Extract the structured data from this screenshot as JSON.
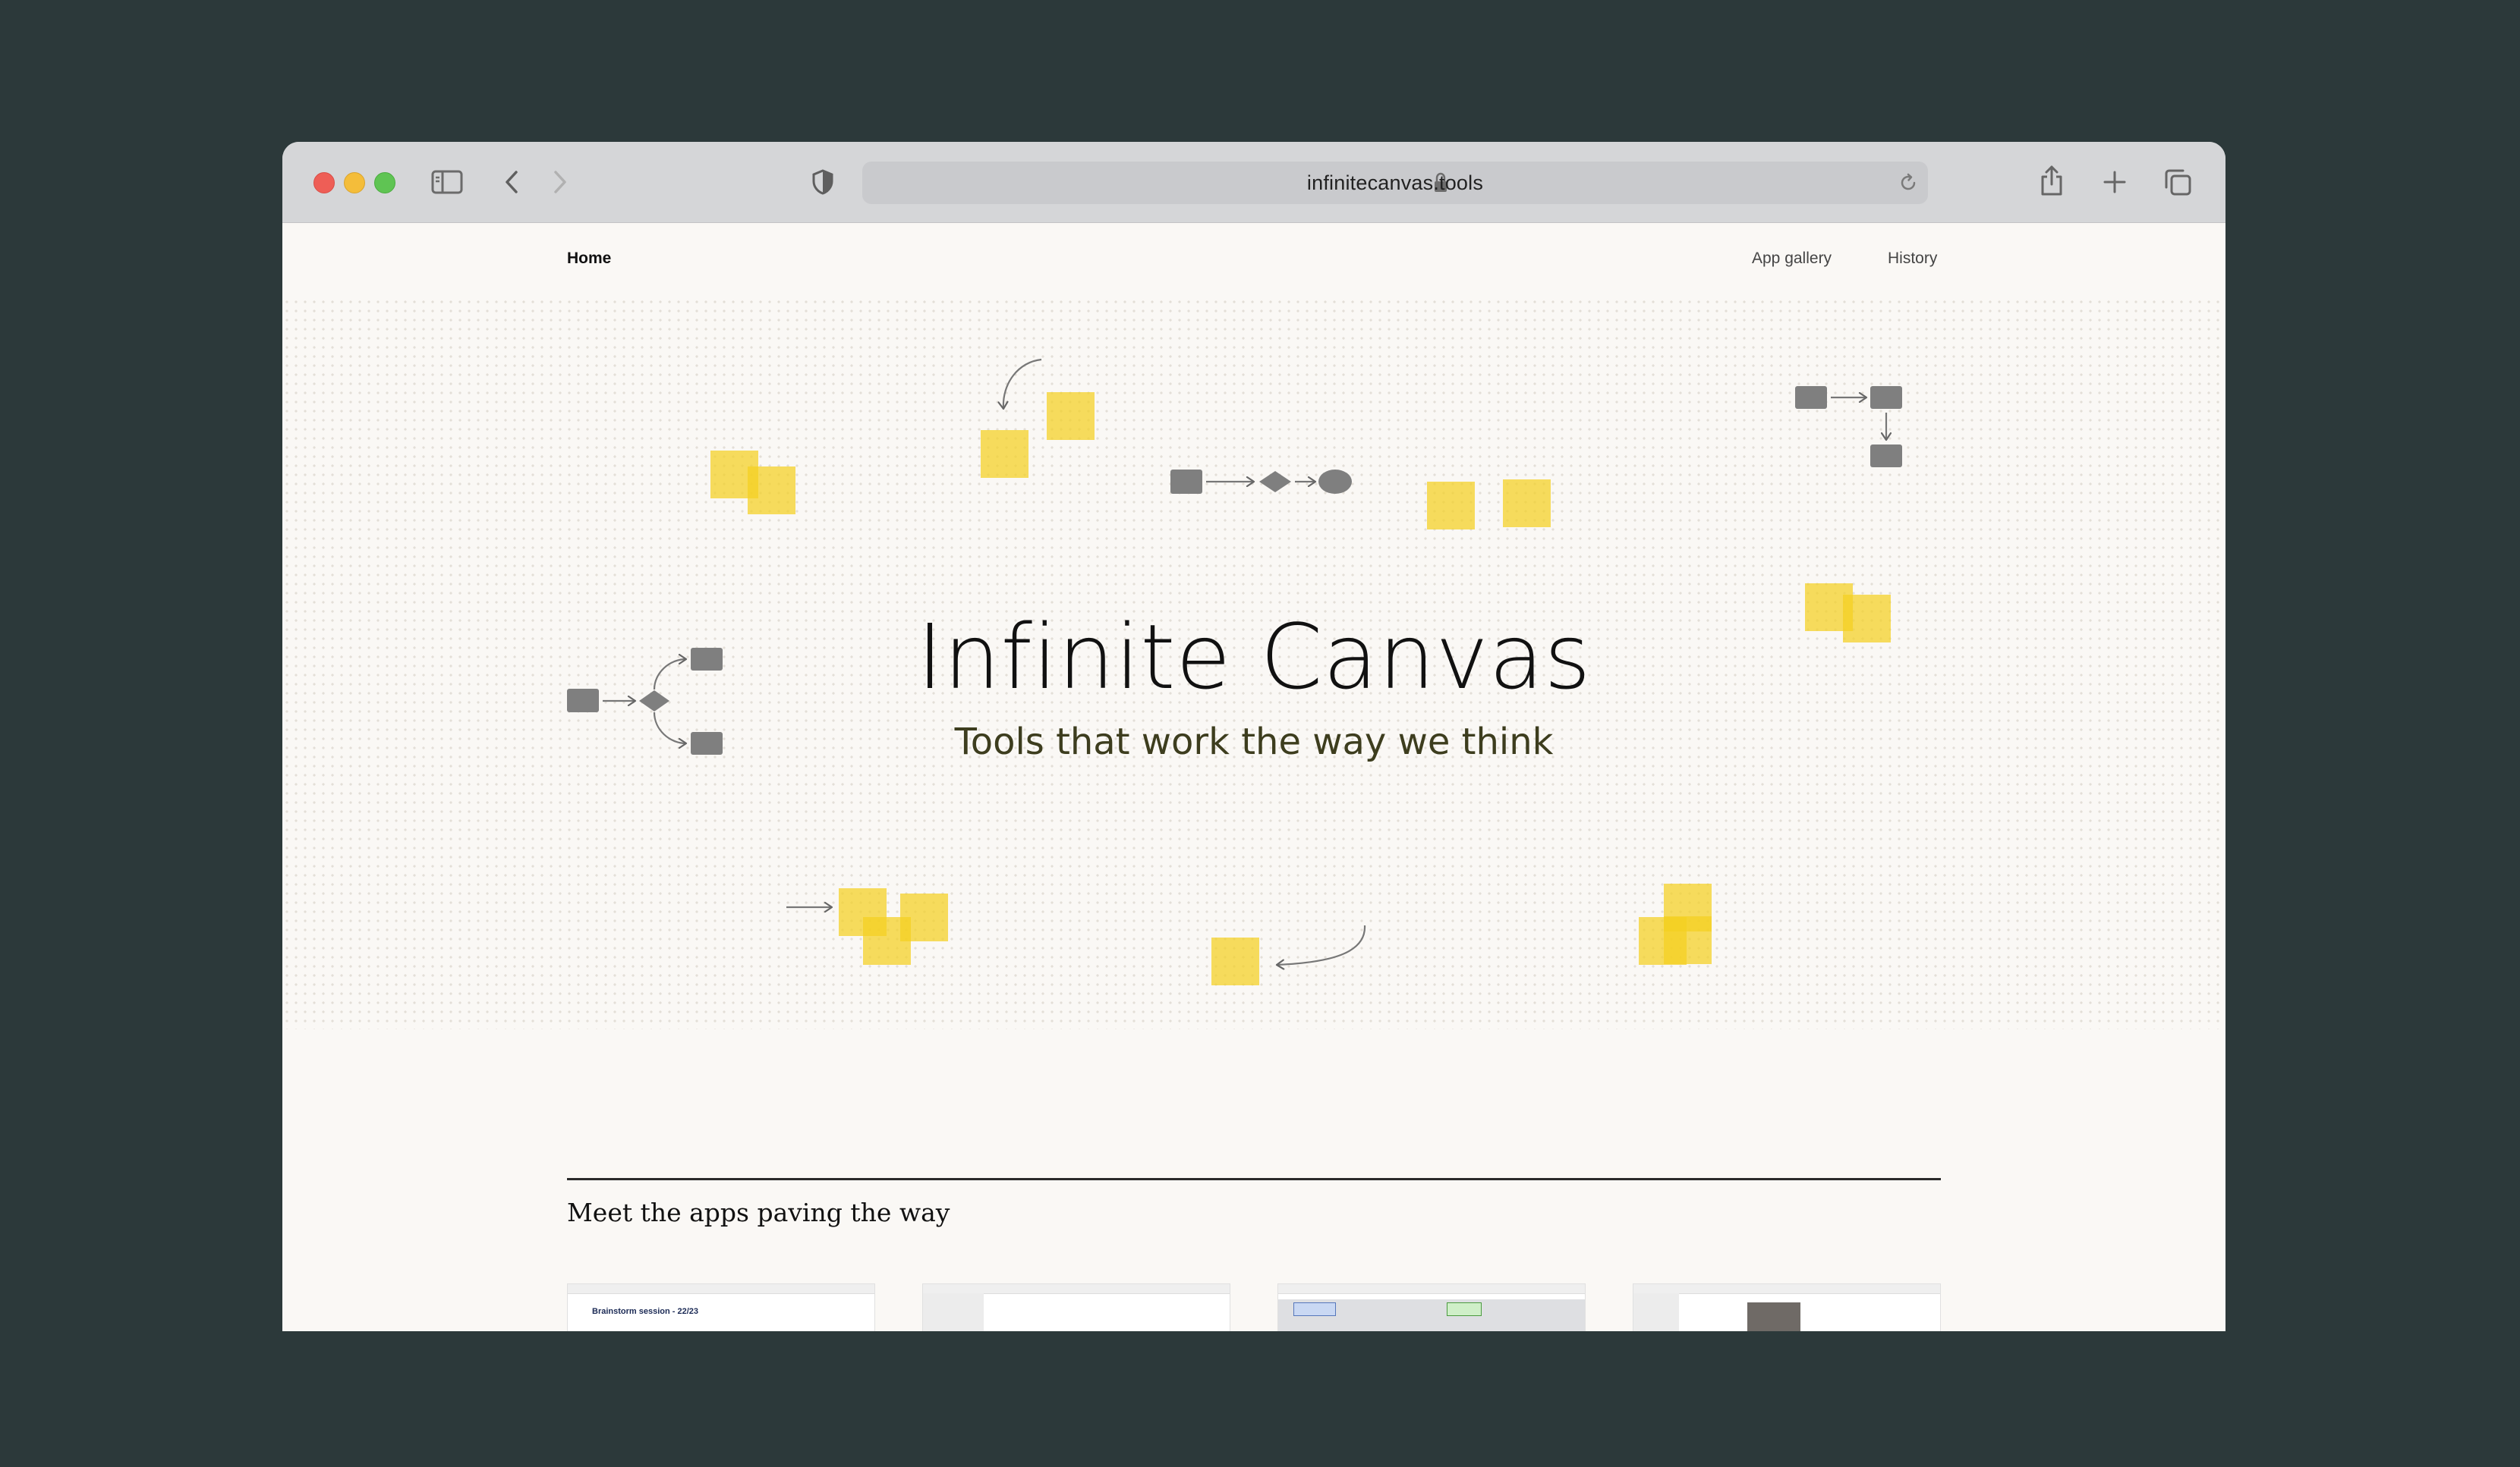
{
  "browser": {
    "url": "infinitecanvas.tools",
    "icons": {
      "sidebar": "sidebar-icon",
      "back": "chevron-left-icon",
      "forward": "chevron-right-icon",
      "shield": "shield-icon",
      "lock": "lock-icon",
      "reload": "reload-icon",
      "share": "share-icon",
      "new_tab": "plus-icon",
      "tabs": "tabs-overview-icon"
    }
  },
  "nav": {
    "home": "Home",
    "app_gallery": "App gallery",
    "history": "History"
  },
  "hero": {
    "title": "Infinite Canvas",
    "subtitle": "Tools that work the way we think"
  },
  "section": {
    "title": "Meet the apps paving the way"
  },
  "thumbnails": [
    {
      "text": "Brainstorm session - 22/23"
    },
    {
      "text": ""
    },
    {
      "text": ""
    },
    {
      "text": ""
    }
  ],
  "colors": {
    "background": "#2c393a",
    "page": "#faf8f5",
    "sticky_note": "#f4d021",
    "diagram_shape": "#7f7f7f",
    "subtitle": "#3d3d1e"
  }
}
